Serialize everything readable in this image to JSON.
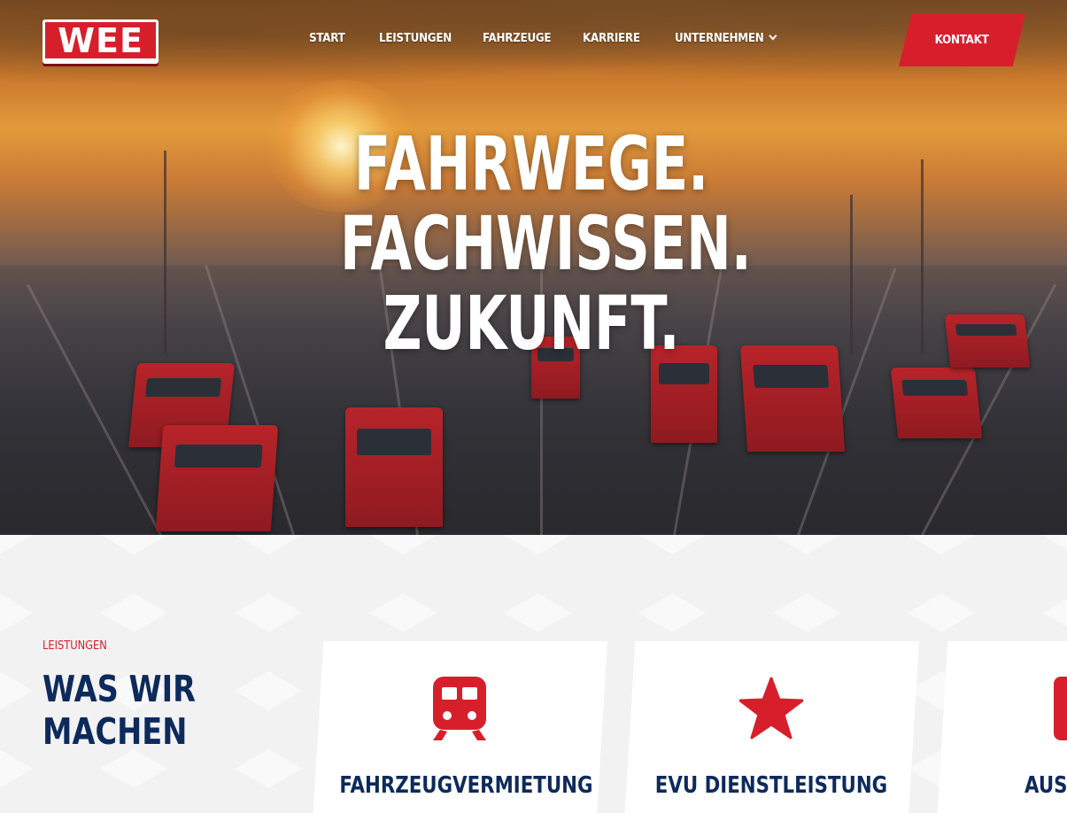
{
  "brand": {
    "logo_text": "WEE",
    "accent": "#d71f2b",
    "navy": "#0d2a5c"
  },
  "nav": {
    "items": [
      {
        "label": "START"
      },
      {
        "label": "LEISTUNGEN"
      },
      {
        "label": "FAHRZEUGE"
      },
      {
        "label": "KARRIERE"
      },
      {
        "label": "UNTERNEHMEN",
        "has_dropdown": true
      }
    ],
    "contact_label": "KONTAKT"
  },
  "hero": {
    "headline_lines": [
      "FAHRWEGE.",
      "FACHWISSEN.",
      "ZUKUNFT."
    ]
  },
  "services": {
    "eyebrow": "LEISTUNGEN",
    "title_lines": [
      "WAS WIR",
      "MACHEN"
    ],
    "cards": [
      {
        "title": "FAHRZEUGVERMIETUNG",
        "icon": "train-icon"
      },
      {
        "title": "EVU DIENSTLEISTUNG",
        "icon": "star-icon"
      },
      {
        "title": "AUSB",
        "icon": "service-icon"
      }
    ]
  }
}
